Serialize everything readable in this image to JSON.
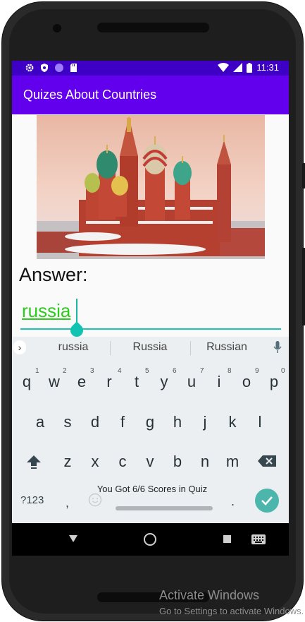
{
  "status_bar": {
    "time": "11:31"
  },
  "app_bar": {
    "title": "Quizes About Countries"
  },
  "quiz": {
    "image_subject": "Saint Basil's Cathedral",
    "answer_label": "Answer:",
    "answer_value": "russia"
  },
  "keyboard": {
    "suggestions": [
      "russia",
      "Russia",
      "Russian"
    ],
    "row1": [
      "q",
      "w",
      "e",
      "r",
      "t",
      "y",
      "u",
      "i",
      "o",
      "p"
    ],
    "row1_hints": [
      "1",
      "2",
      "3",
      "4",
      "5",
      "6",
      "7",
      "8",
      "9",
      "0"
    ],
    "row2": [
      "a",
      "s",
      "d",
      "f",
      "g",
      "h",
      "j",
      "k",
      "l"
    ],
    "row3": [
      "z",
      "x",
      "c",
      "v",
      "b",
      "n",
      "m"
    ],
    "symbols_key": "?123",
    "comma_key": ",",
    "period_key": "."
  },
  "toast": {
    "message": "You Got 6/6 Scores in Quiz"
  },
  "watermark": {
    "title": "Activate Windows",
    "subtitle": "Go to Settings to activate Windows."
  },
  "colors": {
    "status_bar": "#3d00c4",
    "app_bar": "#6200ee",
    "answer_text": "#2ecc1f",
    "accent": "#20c2b2"
  }
}
